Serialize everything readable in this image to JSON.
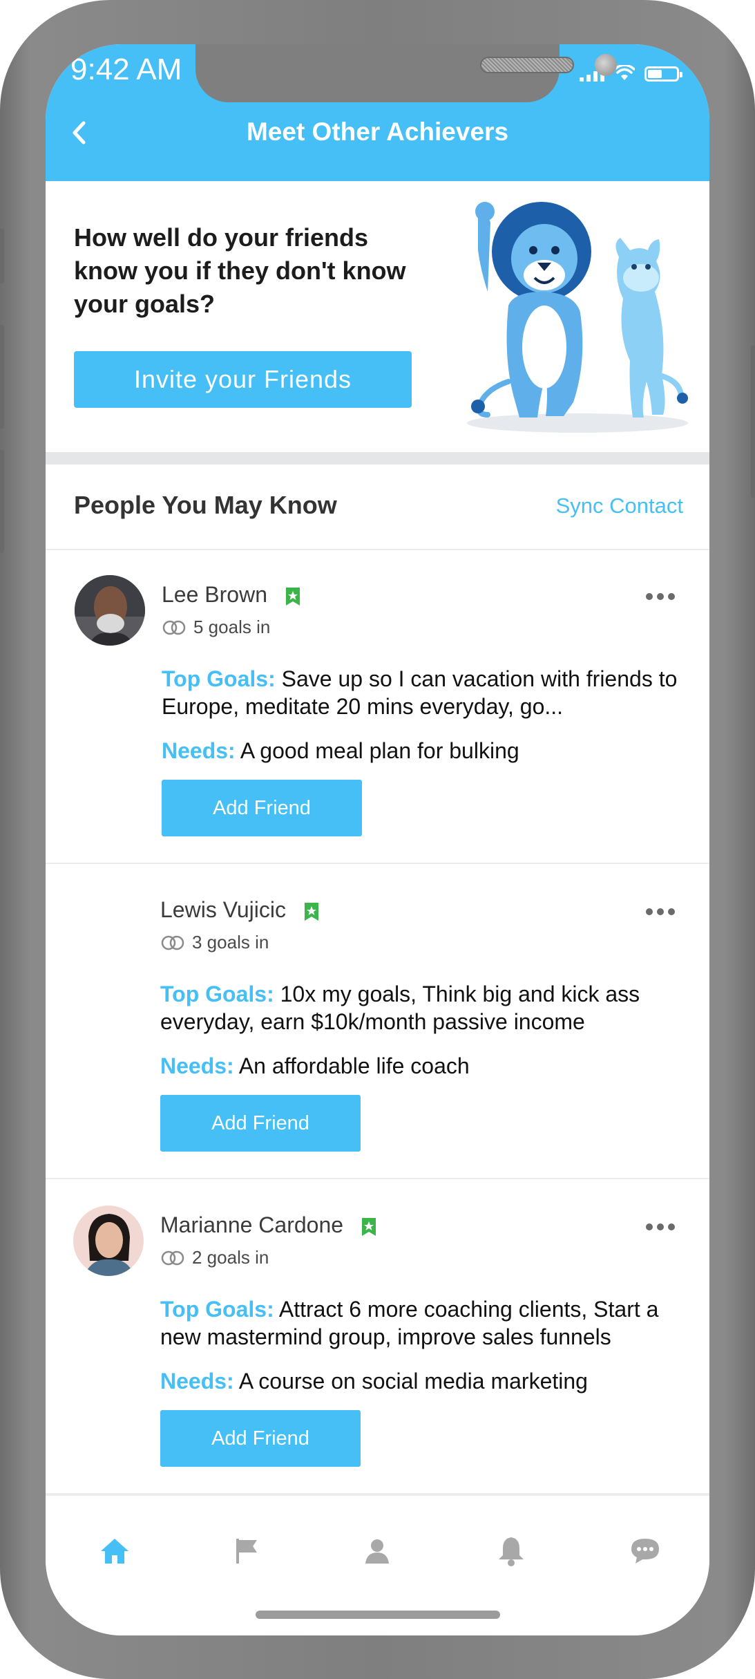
{
  "status_bar": {
    "time": "9:42 AM"
  },
  "header": {
    "title": "Meet Other Achievers"
  },
  "invite": {
    "question": "How well do your friends know you if they don't know your goals?",
    "button_label": "Invite your Friends"
  },
  "people": {
    "title": "People You May Know",
    "sync_label": "Sync Contact",
    "top_goals_label": "Top Goals:",
    "needs_label": "Needs:",
    "add_friend_label": "Add Friend",
    "items": [
      {
        "name": "Lee Brown",
        "goals_count": "5 goals in",
        "top_goals": "Save up so I can vacation with friends to Europe, meditate 20 mins everyday, go...",
        "needs": "A good meal plan for bulking"
      },
      {
        "name": "Lewis Vujicic",
        "goals_count": "3 goals in",
        "top_goals": "10x my goals, Think big and kick ass everyday, earn $10k/month passive income",
        "needs": "An affordable life coach"
      },
      {
        "name": "Marianne Cardone",
        "goals_count": "2 goals in",
        "top_goals": "Attract 6 more coaching clients, Start a new mastermind group, improve sales funnels",
        "needs": "A course on social media marketing"
      }
    ]
  },
  "bottom_nav": {
    "items": [
      {
        "icon": "home-icon",
        "active": true
      },
      {
        "icon": "flag-icon",
        "active": false
      },
      {
        "icon": "profile-icon",
        "active": false
      },
      {
        "icon": "bell-icon",
        "active": false
      },
      {
        "icon": "chat-icon",
        "active": false
      }
    ]
  },
  "colors": {
    "accent": "#45bff5",
    "verified": "#3bb54a",
    "nav_inactive": "#a8a8a8"
  }
}
